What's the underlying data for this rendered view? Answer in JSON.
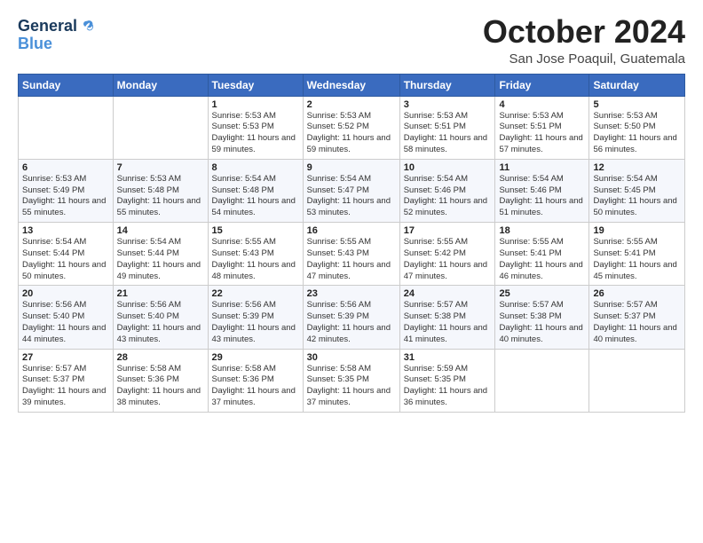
{
  "header": {
    "logo_line1": "General",
    "logo_line2": "Blue",
    "month": "October 2024",
    "location": "San Jose Poaquil, Guatemala"
  },
  "days_of_week": [
    "Sunday",
    "Monday",
    "Tuesday",
    "Wednesday",
    "Thursday",
    "Friday",
    "Saturday"
  ],
  "weeks": [
    [
      {
        "day": "",
        "detail": ""
      },
      {
        "day": "",
        "detail": ""
      },
      {
        "day": "1",
        "detail": "Sunrise: 5:53 AM\nSunset: 5:53 PM\nDaylight: 11 hours\nand 59 minutes."
      },
      {
        "day": "2",
        "detail": "Sunrise: 5:53 AM\nSunset: 5:52 PM\nDaylight: 11 hours\nand 59 minutes."
      },
      {
        "day": "3",
        "detail": "Sunrise: 5:53 AM\nSunset: 5:51 PM\nDaylight: 11 hours\nand 58 minutes."
      },
      {
        "day": "4",
        "detail": "Sunrise: 5:53 AM\nSunset: 5:51 PM\nDaylight: 11 hours\nand 57 minutes."
      },
      {
        "day": "5",
        "detail": "Sunrise: 5:53 AM\nSunset: 5:50 PM\nDaylight: 11 hours\nand 56 minutes."
      }
    ],
    [
      {
        "day": "6",
        "detail": "Sunrise: 5:53 AM\nSunset: 5:49 PM\nDaylight: 11 hours\nand 55 minutes."
      },
      {
        "day": "7",
        "detail": "Sunrise: 5:53 AM\nSunset: 5:48 PM\nDaylight: 11 hours\nand 55 minutes."
      },
      {
        "day": "8",
        "detail": "Sunrise: 5:54 AM\nSunset: 5:48 PM\nDaylight: 11 hours\nand 54 minutes."
      },
      {
        "day": "9",
        "detail": "Sunrise: 5:54 AM\nSunset: 5:47 PM\nDaylight: 11 hours\nand 53 minutes."
      },
      {
        "day": "10",
        "detail": "Sunrise: 5:54 AM\nSunset: 5:46 PM\nDaylight: 11 hours\nand 52 minutes."
      },
      {
        "day": "11",
        "detail": "Sunrise: 5:54 AM\nSunset: 5:46 PM\nDaylight: 11 hours\nand 51 minutes."
      },
      {
        "day": "12",
        "detail": "Sunrise: 5:54 AM\nSunset: 5:45 PM\nDaylight: 11 hours\nand 50 minutes."
      }
    ],
    [
      {
        "day": "13",
        "detail": "Sunrise: 5:54 AM\nSunset: 5:44 PM\nDaylight: 11 hours\nand 50 minutes."
      },
      {
        "day": "14",
        "detail": "Sunrise: 5:54 AM\nSunset: 5:44 PM\nDaylight: 11 hours\nand 49 minutes."
      },
      {
        "day": "15",
        "detail": "Sunrise: 5:55 AM\nSunset: 5:43 PM\nDaylight: 11 hours\nand 48 minutes."
      },
      {
        "day": "16",
        "detail": "Sunrise: 5:55 AM\nSunset: 5:43 PM\nDaylight: 11 hours\nand 47 minutes."
      },
      {
        "day": "17",
        "detail": "Sunrise: 5:55 AM\nSunset: 5:42 PM\nDaylight: 11 hours\nand 47 minutes."
      },
      {
        "day": "18",
        "detail": "Sunrise: 5:55 AM\nSunset: 5:41 PM\nDaylight: 11 hours\nand 46 minutes."
      },
      {
        "day": "19",
        "detail": "Sunrise: 5:55 AM\nSunset: 5:41 PM\nDaylight: 11 hours\nand 45 minutes."
      }
    ],
    [
      {
        "day": "20",
        "detail": "Sunrise: 5:56 AM\nSunset: 5:40 PM\nDaylight: 11 hours\nand 44 minutes."
      },
      {
        "day": "21",
        "detail": "Sunrise: 5:56 AM\nSunset: 5:40 PM\nDaylight: 11 hours\nand 43 minutes."
      },
      {
        "day": "22",
        "detail": "Sunrise: 5:56 AM\nSunset: 5:39 PM\nDaylight: 11 hours\nand 43 minutes."
      },
      {
        "day": "23",
        "detail": "Sunrise: 5:56 AM\nSunset: 5:39 PM\nDaylight: 11 hours\nand 42 minutes."
      },
      {
        "day": "24",
        "detail": "Sunrise: 5:57 AM\nSunset: 5:38 PM\nDaylight: 11 hours\nand 41 minutes."
      },
      {
        "day": "25",
        "detail": "Sunrise: 5:57 AM\nSunset: 5:38 PM\nDaylight: 11 hours\nand 40 minutes."
      },
      {
        "day": "26",
        "detail": "Sunrise: 5:57 AM\nSunset: 5:37 PM\nDaylight: 11 hours\nand 40 minutes."
      }
    ],
    [
      {
        "day": "27",
        "detail": "Sunrise: 5:57 AM\nSunset: 5:37 PM\nDaylight: 11 hours\nand 39 minutes."
      },
      {
        "day": "28",
        "detail": "Sunrise: 5:58 AM\nSunset: 5:36 PM\nDaylight: 11 hours\nand 38 minutes."
      },
      {
        "day": "29",
        "detail": "Sunrise: 5:58 AM\nSunset: 5:36 PM\nDaylight: 11 hours\nand 37 minutes."
      },
      {
        "day": "30",
        "detail": "Sunrise: 5:58 AM\nSunset: 5:35 PM\nDaylight: 11 hours\nand 37 minutes."
      },
      {
        "day": "31",
        "detail": "Sunrise: 5:59 AM\nSunset: 5:35 PM\nDaylight: 11 hours\nand 36 minutes."
      },
      {
        "day": "",
        "detail": ""
      },
      {
        "day": "",
        "detail": ""
      }
    ]
  ]
}
